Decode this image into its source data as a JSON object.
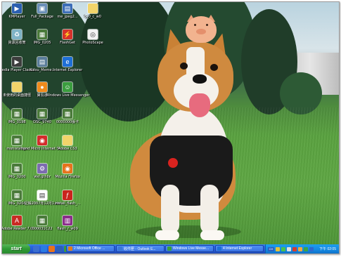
{
  "desktop": {
    "icons": [
      {
        "label": "KMPlayer",
        "icon": "kmplayer-icon",
        "color": "#2b5fb0",
        "glyph": "▶"
      },
      {
        "label": "Full_Package",
        "icon": "package-icon",
        "color": "#6a8fb8",
        "glyph": "▣"
      },
      {
        "label": "me_jpeg2...",
        "icon": "image-file-icon",
        "color": "#3c6db8",
        "glyph": "▤"
      },
      {
        "label": "5_0_c_w0",
        "icon": "folder-icon",
        "color": "#f2d46a",
        "glyph": ""
      },
      {
        "label": "資源回收筒",
        "icon": "recycle-bin-icon",
        "color": "#7fb3c6",
        "glyph": "♻"
      },
      {
        "label": "IMG_0205",
        "icon": "photo-file-icon",
        "color": "#4a7a3a",
        "glyph": "▦"
      },
      {
        "label": "FlashGet",
        "icon": "flashget-icon",
        "color": "#d6322b",
        "glyph": "⚡"
      },
      {
        "label": "PhotoScape",
        "icon": "photoscape-icon",
        "color": "#f3f3f3",
        "glyph": "◎"
      },
      {
        "label": "Media Player Classic",
        "icon": "media-player-icon",
        "color": "#3d3d3d",
        "glyph": "▶"
      },
      {
        "label": "Kutsu_Meme...",
        "icon": "image-file-icon",
        "color": "#5a7d9a",
        "glyph": "▤"
      },
      {
        "label": "Internet Explorer",
        "icon": "internet-explorer-icon",
        "color": "#1e6fd6",
        "glyph": "e"
      },
      {
        "label": "未使用的桌面捷徑",
        "icon": "folder-icon",
        "color": "#f2d46a",
        "glyph": ""
      },
      {
        "label": "寶島通",
        "icon": "app-icon",
        "color": "#f08b1c",
        "glyph": "●"
      },
      {
        "label": "Windows Live Messenger",
        "icon": "messenger-icon",
        "color": "#3a9d3e",
        "glyph": "☺"
      },
      {
        "label": "IMG_0198",
        "icon": "photo-file-icon",
        "color": "#4a7a3a",
        "glyph": "▦"
      },
      {
        "label": "DSC_9740",
        "icon": "photo-file-icon",
        "color": "#4a7a3a",
        "glyph": "▦"
      },
      {
        "label": "0000000張卡",
        "icon": "photo-file-icon",
        "color": "#4a7a3a",
        "glyph": "▦"
      },
      {
        "label": "mohistango",
        "icon": "photo-file-icon",
        "color": "#4a7a3a",
        "glyph": "▦"
      },
      {
        "label": "Trend Micro Internet Se...",
        "icon": "trend-micro-icon",
        "color": "#d42b2b",
        "glyph": "◉"
      },
      {
        "label": "Adobe CS3",
        "icon": "folder-icon",
        "color": "#f2d46a",
        "glyph": ""
      },
      {
        "label": "IMG_0200",
        "icon": "photo-file-icon",
        "color": "#4a7a3a",
        "glyph": "▦"
      },
      {
        "label": "wxl.gthbr",
        "icon": "script-file-icon",
        "color": "#7c6bb0",
        "glyph": "⚙"
      },
      {
        "label": "Mozilla Firefox",
        "icon": "firefox-icon",
        "color": "#e8731c",
        "glyph": "◉"
      },
      {
        "label": "IMG_0204",
        "icon": "photo-file-icon",
        "color": "#4a7a3a",
        "glyph": "▦"
      },
      {
        "label": "記帳2007年12月1.xls",
        "icon": "document-icon",
        "color": "#ffffff",
        "glyph": "▤"
      },
      {
        "label": "install_flash_...",
        "icon": "flash-installer-icon",
        "color": "#c9241d",
        "glyph": "ƒ"
      },
      {
        "label": "Adobe Reader 7.0",
        "icon": "adobe-reader-icon",
        "color": "#c92b23",
        "glyph": "A"
      },
      {
        "label": "000031C22",
        "icon": "photo-file-icon",
        "color": "#4a7a3a",
        "glyph": "▦"
      },
      {
        "label": "flash_r_w09",
        "icon": "archive-icon",
        "color": "#8b2c8b",
        "glyph": "▥"
      }
    ]
  },
  "taskbar": {
    "start_label": "start",
    "quick_launch": [
      {
        "icon": "show-desktop-icon",
        "color": "#3b6fd0"
      },
      {
        "icon": "internet-explorer-icon",
        "color": "#2a7be3"
      },
      {
        "icon": "firefox-icon",
        "color": "#e8731c"
      },
      {
        "icon": "media-player-icon",
        "color": "#2f5fb3"
      },
      {
        "icon": "messenger-icon",
        "color": "#3a9d3e"
      }
    ],
    "tasks": [
      {
        "label": "2 Microsoft Office ...",
        "icon": "office-icon",
        "color": "#e07b1a"
      },
      {
        "label": "收件匣 - Outlook E...",
        "icon": "outlook-icon",
        "color": "#3b79d6"
      },
      {
        "label": "Windows Live Messe...",
        "icon": "messenger-icon",
        "color": "#3a9d3e"
      },
      {
        "label": "4 Internet Explorer",
        "icon": "internet-explorer-icon",
        "color": "#1e6fd6"
      }
    ],
    "tray": {
      "ime": "CH",
      "icons": [
        "tray-app-icon",
        "network-icon",
        "volume-icon",
        "security-icon",
        "update-icon",
        "messenger-tray-icon",
        "tray-shield-icon"
      ],
      "clock": "下午 02:05"
    }
  }
}
